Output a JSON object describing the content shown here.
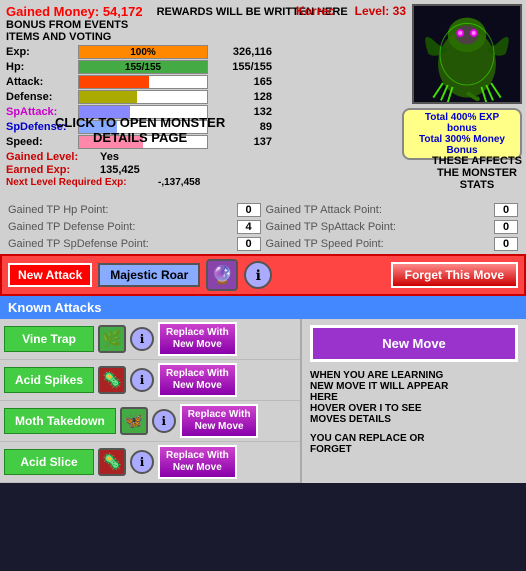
{
  "header": {
    "gained_money_label": "Gained Money:",
    "gained_money_value": "54,172",
    "rewards_text": "REWARDS WILL BE WRITTEN HERE",
    "bonus_events": "BONUS FROM EVENTS",
    "items_voting": "ITEMS AND VOTING"
  },
  "monster": {
    "name": "Korrec",
    "level_label": "Level:",
    "level": "33"
  },
  "stats": [
    {
      "label": "Exp:",
      "bar_pct": 100,
      "bar_type": "exp",
      "bar_text": "100%",
      "value": "326,116",
      "label_color": "normal"
    },
    {
      "label": "Hp:",
      "bar_pct": 100,
      "bar_type": "hp",
      "bar_text": "155/155",
      "value": "155/155",
      "label_color": "normal"
    },
    {
      "label": "Attack:",
      "bar_pct": 55,
      "bar_type": "attack",
      "bar_text": "",
      "value": "165",
      "label_color": "normal"
    },
    {
      "label": "Defense:",
      "bar_pct": 45,
      "bar_type": "defense",
      "bar_text": "",
      "value": "128",
      "label_color": "normal"
    },
    {
      "label": "SpAttack:",
      "bar_pct": 40,
      "bar_type": "spattack",
      "bar_text": "",
      "value": "132",
      "label_color": "pink"
    },
    {
      "label": "SpDefense:",
      "bar_pct": 30,
      "bar_type": "spdefense",
      "bar_text": "",
      "value": "89",
      "label_color": "blue"
    },
    {
      "label": "Speed:",
      "bar_pct": 50,
      "bar_type": "speed",
      "bar_text": "",
      "value": "137",
      "label_color": "normal"
    }
  ],
  "click_text": "CLICK TO OPEN MONSTER\nDETAILS PAGE",
  "gained_level": {
    "label": "Gained Level:",
    "value": "Yes"
  },
  "earned_exp": {
    "label": "Earned Exp:",
    "value": "135,425"
  },
  "next_level": {
    "label": "Next Level Required Exp:",
    "value": "-,137,458"
  },
  "bonus_box": {
    "line1": "Total 400% EXP bonus",
    "line2": "Total 300% Money",
    "line3": "Bonus"
  },
  "affects_text": "THESE AFFECTS\nTHE MONSTER\nSTATS",
  "tp_points": [
    {
      "label": "Gained TP Hp Point:",
      "value": "0"
    },
    {
      "label": "Gained TP Attack Point:",
      "value": "0"
    },
    {
      "label": "Gained TP Defense Point:",
      "value": "4"
    },
    {
      "label": "Gained TP SpAttack Point:",
      "value": "0"
    },
    {
      "label": "Gained TP SpDefense Point:",
      "value": "0"
    },
    {
      "label": "Gained TP Speed Point:",
      "value": "0"
    }
  ],
  "attack_bar": {
    "new_attack_label": "New Attack",
    "majestic_roar_label": "Majestic Roar",
    "forget_label": "Forget This Move"
  },
  "known_attacks_header": "Known Attacks",
  "attacks": [
    {
      "name": "Vine Trap",
      "icon": "🌿",
      "icon_type": "green-icon"
    },
    {
      "name": "Acid Spikes",
      "icon": "🦠",
      "icon_type": "red-icon"
    },
    {
      "name": "Moth Takedown",
      "icon": "🦋",
      "icon_type": "green-icon"
    },
    {
      "name": "Acid Slice",
      "icon": "🦠",
      "icon_type": "red-icon"
    }
  ],
  "replace_btn_label": "Replace With\nNew Move",
  "new_move_label": "New Move",
  "help_texts": {
    "new_move_info": "WHEN YOU ARE LEARNING\nNEW MOVE IT WILL APPEAR\nHERE\nHOVER OVER I TO SEE\nMOVES DETAILS",
    "replace_info": "YOU CAN REPLACE OR\nFORGET"
  }
}
